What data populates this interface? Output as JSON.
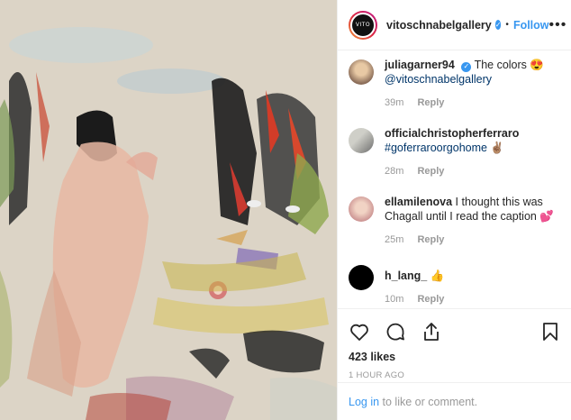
{
  "header": {
    "avatar_text": "VITO",
    "username": "vitoschnabelgallery",
    "separator": "•",
    "follow_label": "Follow",
    "more_label": "•••"
  },
  "comments": [
    {
      "user": "juliagarner94",
      "verified": true,
      "text": "The colors 😍",
      "mention": "@vitoschnabelgallery",
      "time": "39m",
      "reply": "Reply"
    },
    {
      "user": "officialchristopherferraro",
      "verified": false,
      "text": "",
      "mention": "#goferraroorgohome ✌🏽",
      "time": "28m",
      "reply": "Reply"
    },
    {
      "user": "ellamilenova",
      "verified": false,
      "text": "I thought this was Chagall until I read the caption 💕",
      "mention": "",
      "time": "25m",
      "reply": "Reply"
    },
    {
      "user": "h_lang_",
      "verified": false,
      "text": "👍",
      "mention": "",
      "time": "10m",
      "reply": "Reply"
    }
  ],
  "actions": {
    "like_icon": "heart-icon",
    "comment_icon": "comment-icon",
    "share_icon": "share-icon",
    "save_icon": "bookmark-icon"
  },
  "likes": "423 likes",
  "posted": "1 HOUR AGO",
  "login": {
    "link": "Log in",
    "text": " to like or comment."
  },
  "colors": {
    "accent": "#3897f0",
    "link": "#003569",
    "muted": "#999999"
  }
}
